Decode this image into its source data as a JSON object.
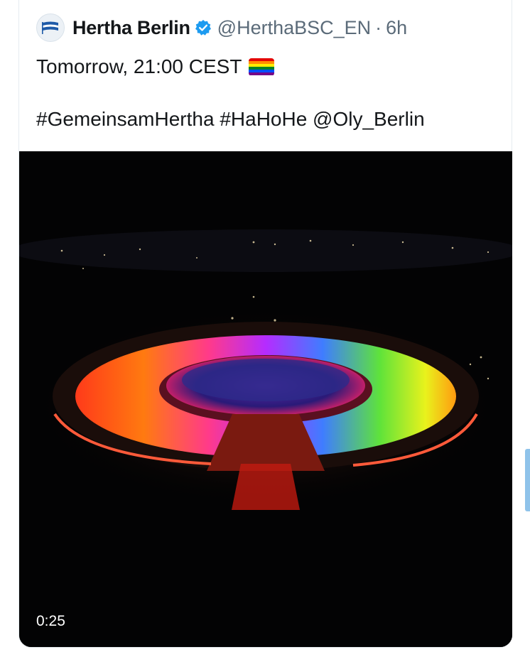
{
  "tweet": {
    "author": {
      "display_name": "Hertha Berlin",
      "handle": "@HerthaBSC_EN",
      "verified": true,
      "avatar_icon": "hertha-flag-logo-icon"
    },
    "separator": "·",
    "time": "6h",
    "text_line1": "Tomorrow, 21:00 CEST",
    "emoji": "rainbow-flag-icon",
    "text_line2": "#GemeinsamHertha #HaHoHe @Oly_Berlin",
    "media": {
      "type": "video",
      "description_icon": "lit-stadium-video-thumbnail",
      "duration": "0:25"
    }
  },
  "colors": {
    "verified_blue": "#1d9bf0",
    "text": "#14171a",
    "secondary_text": "#5b6b79",
    "rainbow": [
      "#e40303",
      "#ff8c00",
      "#ffed00",
      "#008026",
      "#004dff",
      "#750787"
    ]
  }
}
